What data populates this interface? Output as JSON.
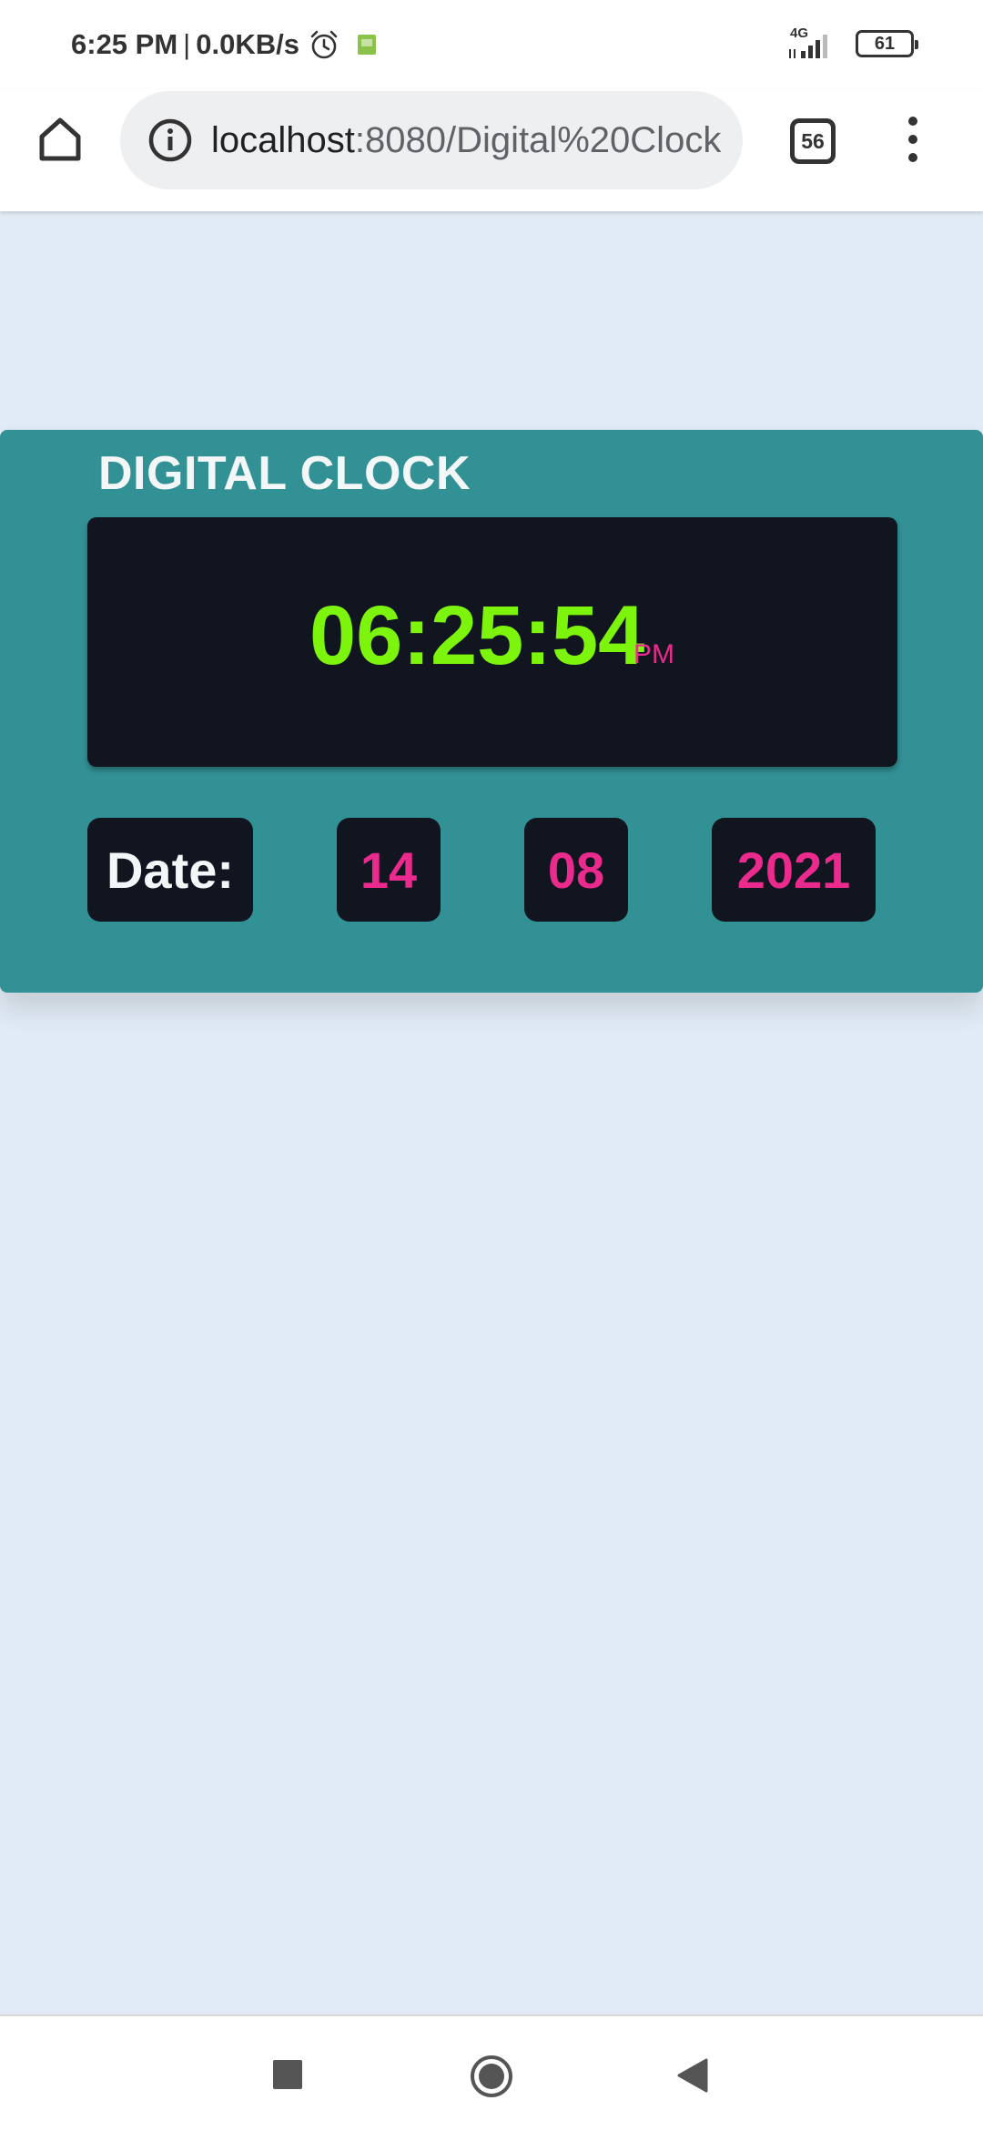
{
  "status_bar": {
    "time": "6:25 PM",
    "separator": "|",
    "net_speed": "0.0KB/s",
    "network_type": "4G",
    "battery": "61",
    "icons": [
      "alarm-icon",
      "app-notification-icon",
      "signal-icon",
      "battery-icon"
    ]
  },
  "browser": {
    "url_host": "localhost",
    "url_rest": ":8080/Digital%20Clock",
    "tab_count": "56",
    "icons": [
      "home-icon",
      "info-icon",
      "tabs-icon",
      "overflow-menu-icon"
    ]
  },
  "clock": {
    "title": "DIGITAL CLOCK",
    "time": "06:25:54",
    "ampm": "PM",
    "date_label": "Date:",
    "day": "14",
    "month": "08",
    "year": "2021",
    "colors": {
      "card": "#329195",
      "display": "#111520",
      "time": "#7cf40c",
      "accent": "#ea2a8c",
      "page_bg": "#e1ebf5"
    }
  },
  "nav": {
    "icons": [
      "recent-apps-icon",
      "home-circle-icon",
      "back-icon"
    ]
  }
}
